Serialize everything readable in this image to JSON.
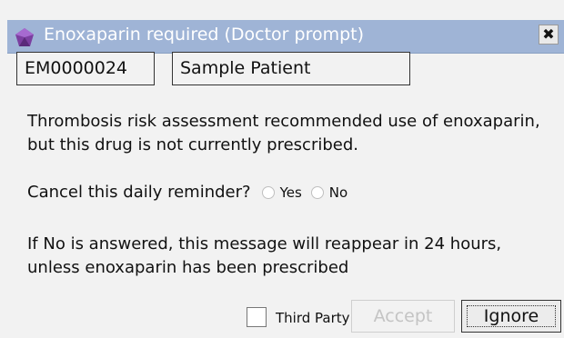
{
  "dialog": {
    "title": "Enoxaparin required (Doctor prompt)",
    "close_symbol": "✖",
    "icon": "purple-gem-icon",
    "title_bar_color": "#9fb4d6"
  },
  "patient": {
    "id": "EM0000024",
    "name": "Sample Patient"
  },
  "message": {
    "line1": "Thrombosis risk assessment recommended use of enoxaparin,",
    "line2": "but this drug is not currently prescribed.",
    "note_line1": "If No is answered, this message will reappear in 24 hours,",
    "note_line2": "unless enoxaparin has been prescribed"
  },
  "reminder": {
    "question": "Cancel this daily reminder?",
    "options": [
      "Yes",
      "No"
    ]
  },
  "footer": {
    "third_party_label": "Third Party",
    "accept_label": "Accept",
    "ignore_label": "Ignore"
  }
}
